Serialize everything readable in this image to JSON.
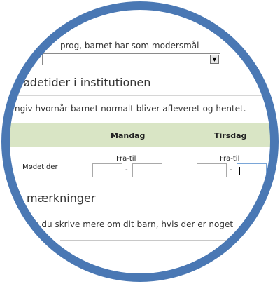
{
  "language": {
    "label": "prog, barnet har som modersmål",
    "selected_value": ""
  },
  "attendance": {
    "heading": "ødetider i institutionen",
    "instruction": "ngiv hvornår barnet normalt bliver afleveret og hentet.",
    "days": [
      {
        "name": "Mandag",
        "range_label": "Fra-til"
      },
      {
        "name": "Tirsdag",
        "range_label": "Fra-til"
      }
    ],
    "row_label": "Mødetider",
    "separator": "-"
  },
  "remarks": {
    "heading": "mærkninger",
    "instruction": "n du skrive mere om dit barn, hvis der er noget"
  },
  "colors": {
    "ring": "#4a78b4",
    "header_band": "#d9e5c5"
  }
}
